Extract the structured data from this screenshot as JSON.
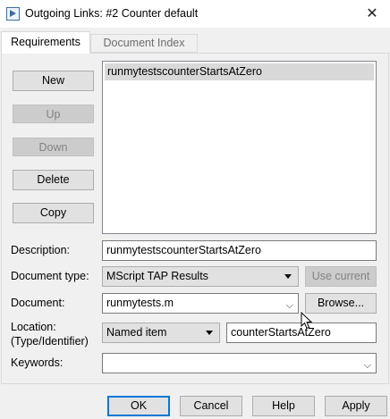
{
  "window": {
    "title": "Outgoing Links: #2 Counter default",
    "close_glyph": "✕"
  },
  "tabs": [
    {
      "label": "Requirements",
      "active": true
    },
    {
      "label": "Document Index",
      "active": false
    }
  ],
  "side_buttons": {
    "new": "New",
    "up": "Up",
    "down": "Down",
    "delete": "Delete",
    "copy": "Copy"
  },
  "requirements_list": {
    "items": [
      "runmytestscounterStartsAtZero"
    ],
    "selected_index": 0
  },
  "form": {
    "description": {
      "label": "Description:",
      "value": "runmytestscounterStartsAtZero"
    },
    "document_type": {
      "label": "Document type:",
      "value": "MScript TAP Results",
      "use_current": "Use current"
    },
    "document": {
      "label": "Document:",
      "value": "runmytests.m",
      "browse": "Browse..."
    },
    "location": {
      "label_line1": "Location:",
      "label_line2": "(Type/Identifier)",
      "type": "Named item",
      "identifier": "counterStartsAtZero"
    },
    "keywords": {
      "label": "Keywords:",
      "value": ""
    }
  },
  "footer": {
    "ok": "OK",
    "cancel": "Cancel",
    "help": "Help",
    "apply": "Apply"
  },
  "icons": {
    "app": "simulink-link-icon",
    "dropdown": "dropdown-arrow-icon",
    "cursor": "mouse-pointer-icon"
  },
  "colors": {
    "selection": "#d9d9d9",
    "default_button_border": "#0078d7",
    "disabled_text": "#838383"
  }
}
